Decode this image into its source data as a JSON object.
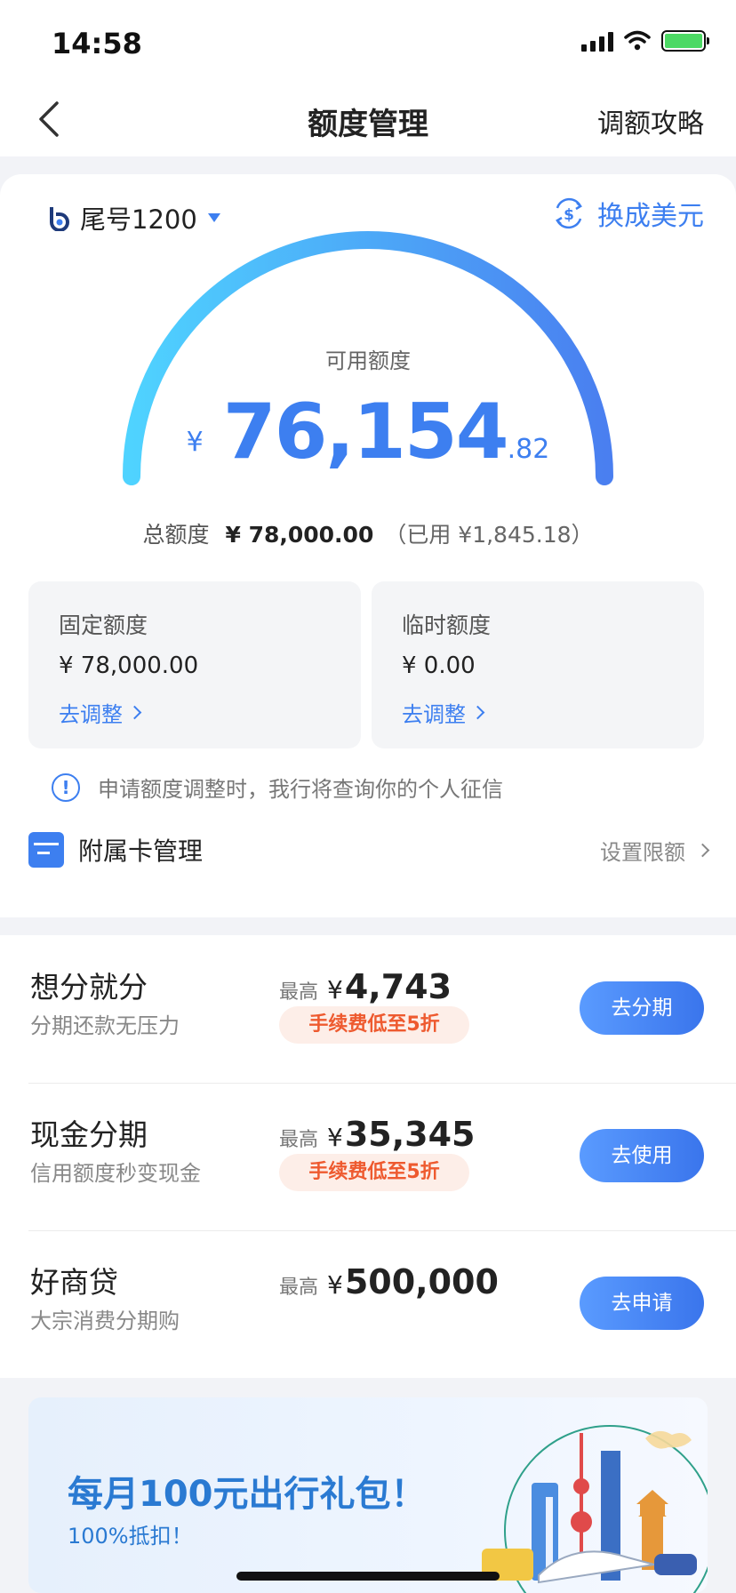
{
  "status_bar": {
    "time": "14:58"
  },
  "nav": {
    "title": "额度管理",
    "right_link": "调额攻略"
  },
  "card": {
    "selector_label": "尾号1200",
    "convert_label": "换成美元"
  },
  "available": {
    "label": "可用额度",
    "currency": "¥",
    "integer": "76,154",
    "decimal": ".82"
  },
  "total": {
    "label": "总额度",
    "value": "¥ 78,000.00",
    "used": "（已用 ¥1,845.18）"
  },
  "limits": [
    {
      "title": "固定额度",
      "value": "¥ 78,000.00",
      "link": "去调整"
    },
    {
      "title": "临时额度",
      "value": "¥ 0.00",
      "link": "去调整"
    }
  ],
  "notice": "申请额度调整时，我行将查询你的个人征信",
  "supplementary": {
    "label": "附属卡管理",
    "action": "设置限额"
  },
  "products": [
    {
      "title": "想分就分",
      "subtitle": "分期还款无压力",
      "max_label": "最高",
      "currency": "¥",
      "amount": "4,743",
      "fee_tag": "手续费低至5折",
      "button": "去分期"
    },
    {
      "title": "现金分期",
      "subtitle": "信用额度秒变现金",
      "max_label": "最高",
      "currency": "¥",
      "amount": "35,345",
      "fee_tag": "手续费低至5折",
      "button": "去使用"
    },
    {
      "title": "好商贷",
      "subtitle": "大宗消费分期购",
      "max_label": "最高",
      "currency": "¥",
      "amount": "500,000",
      "button": "去申请"
    }
  ],
  "banner": {
    "title": "每月100元出行礼包！",
    "subtitle": "100%抵扣！"
  },
  "colors": {
    "accent": "#3d7ff0",
    "gauge_start": "#4fd3ff",
    "gauge_end": "#4a7ff0",
    "fee_tag_text": "#ee5a2f",
    "fee_tag_bg": "#fdeee8"
  },
  "icons": [
    "signal-icon",
    "wifi-icon",
    "battery-charging-icon",
    "back-arrow-icon",
    "bank-logo-icon",
    "dollar-exchange-icon",
    "info-icon",
    "card-icon",
    "chevron-right-icon"
  ]
}
